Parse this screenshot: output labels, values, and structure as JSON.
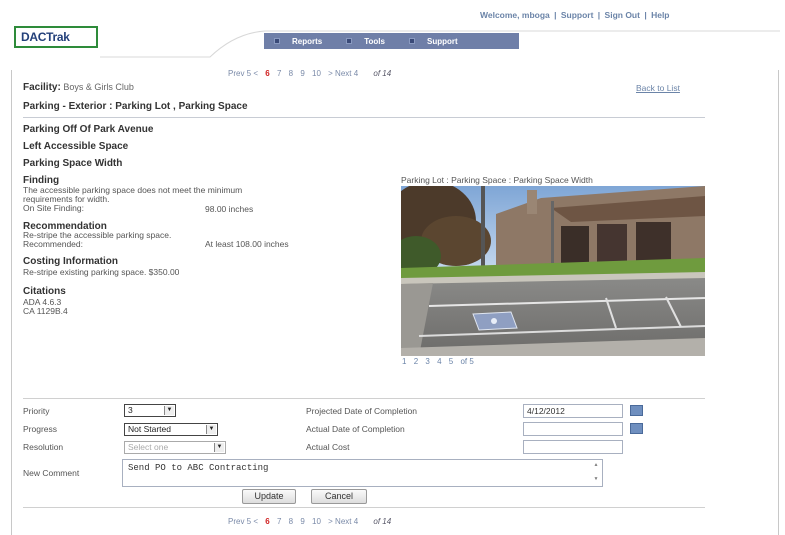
{
  "header": {
    "welcome": "Welcome, mboga",
    "links": [
      "Support",
      "Sign Out",
      "Help"
    ],
    "logo_text": "DACTrak",
    "nav": [
      "Reports",
      "Tools",
      "Support"
    ]
  },
  "pager": {
    "prev": "Prev 5 <",
    "pages": [
      "6",
      "7",
      "8",
      "9",
      "10"
    ],
    "current": "6",
    "next": "> Next 4",
    "of": "of 14"
  },
  "facility": {
    "label": "Facility:",
    "value": "Boys & Girls Club",
    "back": "Back to List"
  },
  "section_title": "Parking - Exterior : Parking Lot , Parking Space",
  "headings": [
    "Parking Off Of Park Avenue",
    "Left Accessible Space",
    "Parking Space Width"
  ],
  "finding": {
    "title": "Finding",
    "text_line1": "The accessible parking space does not meet the minimum",
    "text_line2": "requirements for width.",
    "onsite_label": "On Site Finding:",
    "onsite_value": "98.00 inches"
  },
  "recommendation": {
    "title": "Recommendation",
    "text": "Re-stripe the accessible parking space.",
    "label": "Recommended:",
    "value": "At least 108.00 inches"
  },
  "costing": {
    "title": "Costing Information",
    "text": "Re-stripe existing parking space. $350.00"
  },
  "citations": {
    "title": "Citations",
    "items": [
      "ADA 4.6.3",
      "CA 1129B.4"
    ]
  },
  "photo": {
    "caption": "Parking Lot : Parking Space : Parking Space Width",
    "pages": [
      "1",
      "2",
      "3",
      "4",
      "5"
    ],
    "of": "of 5"
  },
  "form": {
    "priority_label": "Priority",
    "priority_value": "3",
    "progress_label": "Progress",
    "progress_value": "Not Started",
    "resolution_label": "Resolution",
    "resolution_value": "Select one",
    "comment_label": "New Comment",
    "comment_value": "Send PO to ABC Contracting",
    "projected_label": "Projected Date of Completion",
    "projected_value": "4/12/2012",
    "actual_date_label": "Actual Date of Completion",
    "actual_date_value": "",
    "actual_cost_label": "Actual Cost",
    "actual_cost_value": "",
    "update_label": "Update",
    "cancel_label": "Cancel"
  },
  "colors": {
    "nav_bg": "#6f7fa8",
    "link": "#6b84a8",
    "current_page": "#d02020",
    "logo_border": "#2e8b3a"
  }
}
